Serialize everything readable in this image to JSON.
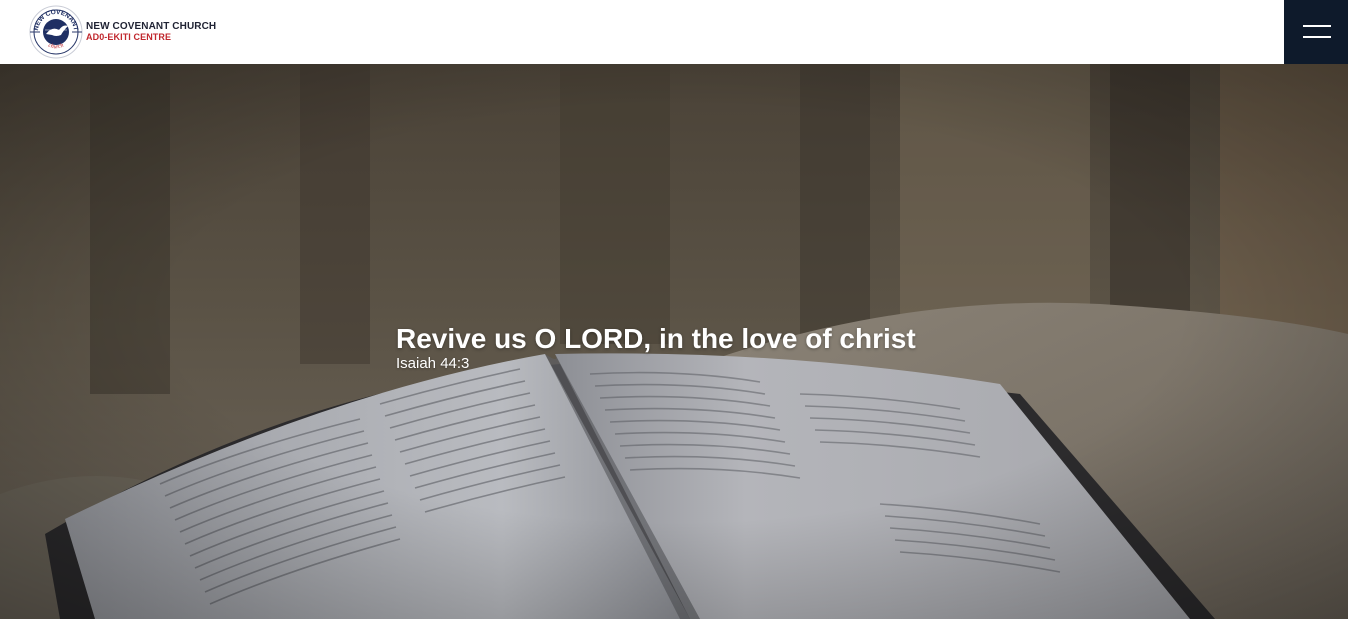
{
  "header": {
    "brand_name": "NEW COVENANT CHURCH",
    "brand_sub": "AD0-EKITI CENTRE",
    "logo_text_top": "NEW COVENANT",
    "logo_text_bottom": "church",
    "logo_icon": "dove-globe-logo",
    "menu_icon": "hamburger-menu-icon"
  },
  "hero": {
    "title": "Revive us O LORD, in the love of christ",
    "reference": "Isaiah 44:3"
  },
  "colors": {
    "brand_sub": "#c0272d",
    "menu_bg": "#0e1a2b",
    "brand_name": "#1f2233"
  }
}
